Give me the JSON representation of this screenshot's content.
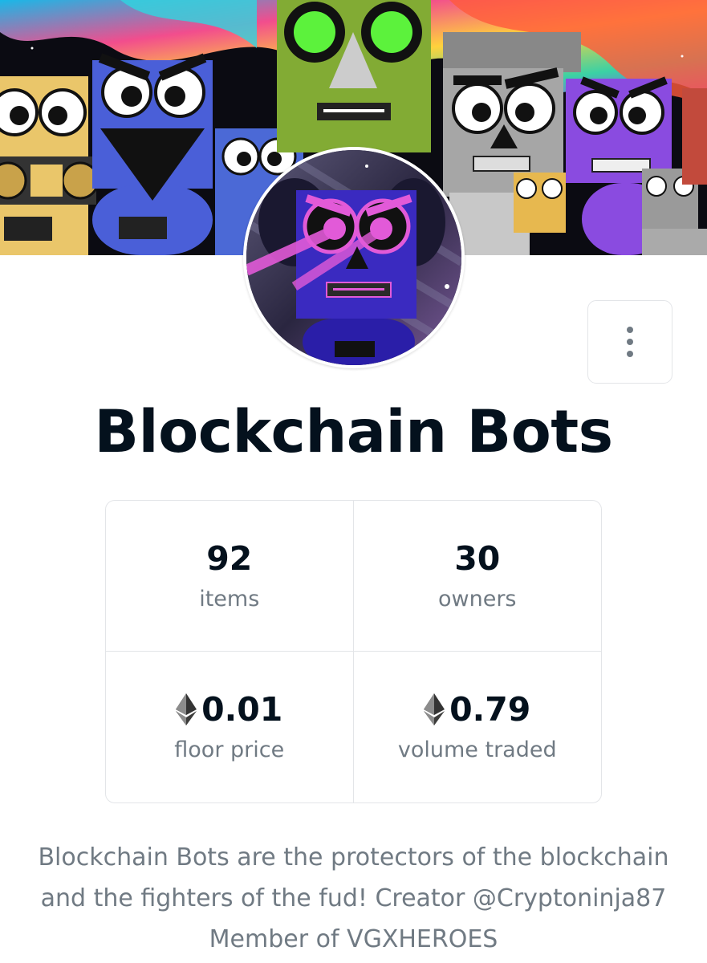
{
  "collection": {
    "name": "Blockchain Bots",
    "description": "Blockchain Bots are the protectors of the blockchain and the fighters of the fud! Creator @Cryptoninja87 Member of VGXHEROES"
  },
  "stats": [
    {
      "value": "92",
      "label": "items",
      "icon": ""
    },
    {
      "value": "30",
      "label": "owners",
      "icon": ""
    },
    {
      "value": "0.01",
      "label": "floor price",
      "icon": "ethereum-icon"
    },
    {
      "value": "0.79",
      "label": "volume traded",
      "icon": "ethereum-icon"
    }
  ],
  "colors": {
    "title": "#04111d",
    "muted": "#707a83",
    "border": "#e3e5e8"
  },
  "menu": {
    "icon": "more-vertical-icon"
  }
}
